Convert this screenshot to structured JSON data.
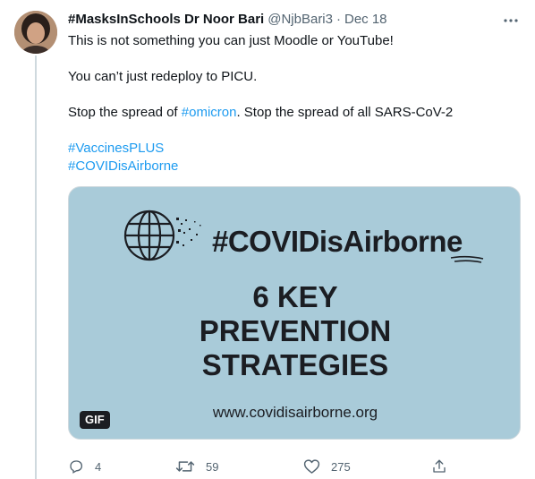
{
  "tweet": {
    "display_name": "#MasksInSchools Dr Noor Bari",
    "handle": "@NjbBari3",
    "separator": "·",
    "date": "Dec 18",
    "text": {
      "line1": "This is not something you can just Moodle or YouTube!",
      "line2": "You can’t just redeploy to PICU.",
      "line3_prefix": "Stop the spread of ",
      "line3_link": "#omicron",
      "line3_suffix": ". Stop the spread of all SARS-CoV-2",
      "hashtag1": "#VaccinesPLUS",
      "hashtag2": "#COVIDisAirborne"
    },
    "media": {
      "hashtag": "#COVIDisAirborne",
      "headline_line1": "6 KEY",
      "headline_line2": "PREVENTION",
      "headline_line3": "STRATEGIES",
      "url": "www.covidisairborne.org",
      "badge": "GIF"
    },
    "actions": {
      "replies": "4",
      "retweets": "59",
      "likes": "275"
    }
  },
  "colors": {
    "link": "#1d9bf0",
    "secondary_text": "#536471",
    "media_background": "#a9cbd9"
  }
}
